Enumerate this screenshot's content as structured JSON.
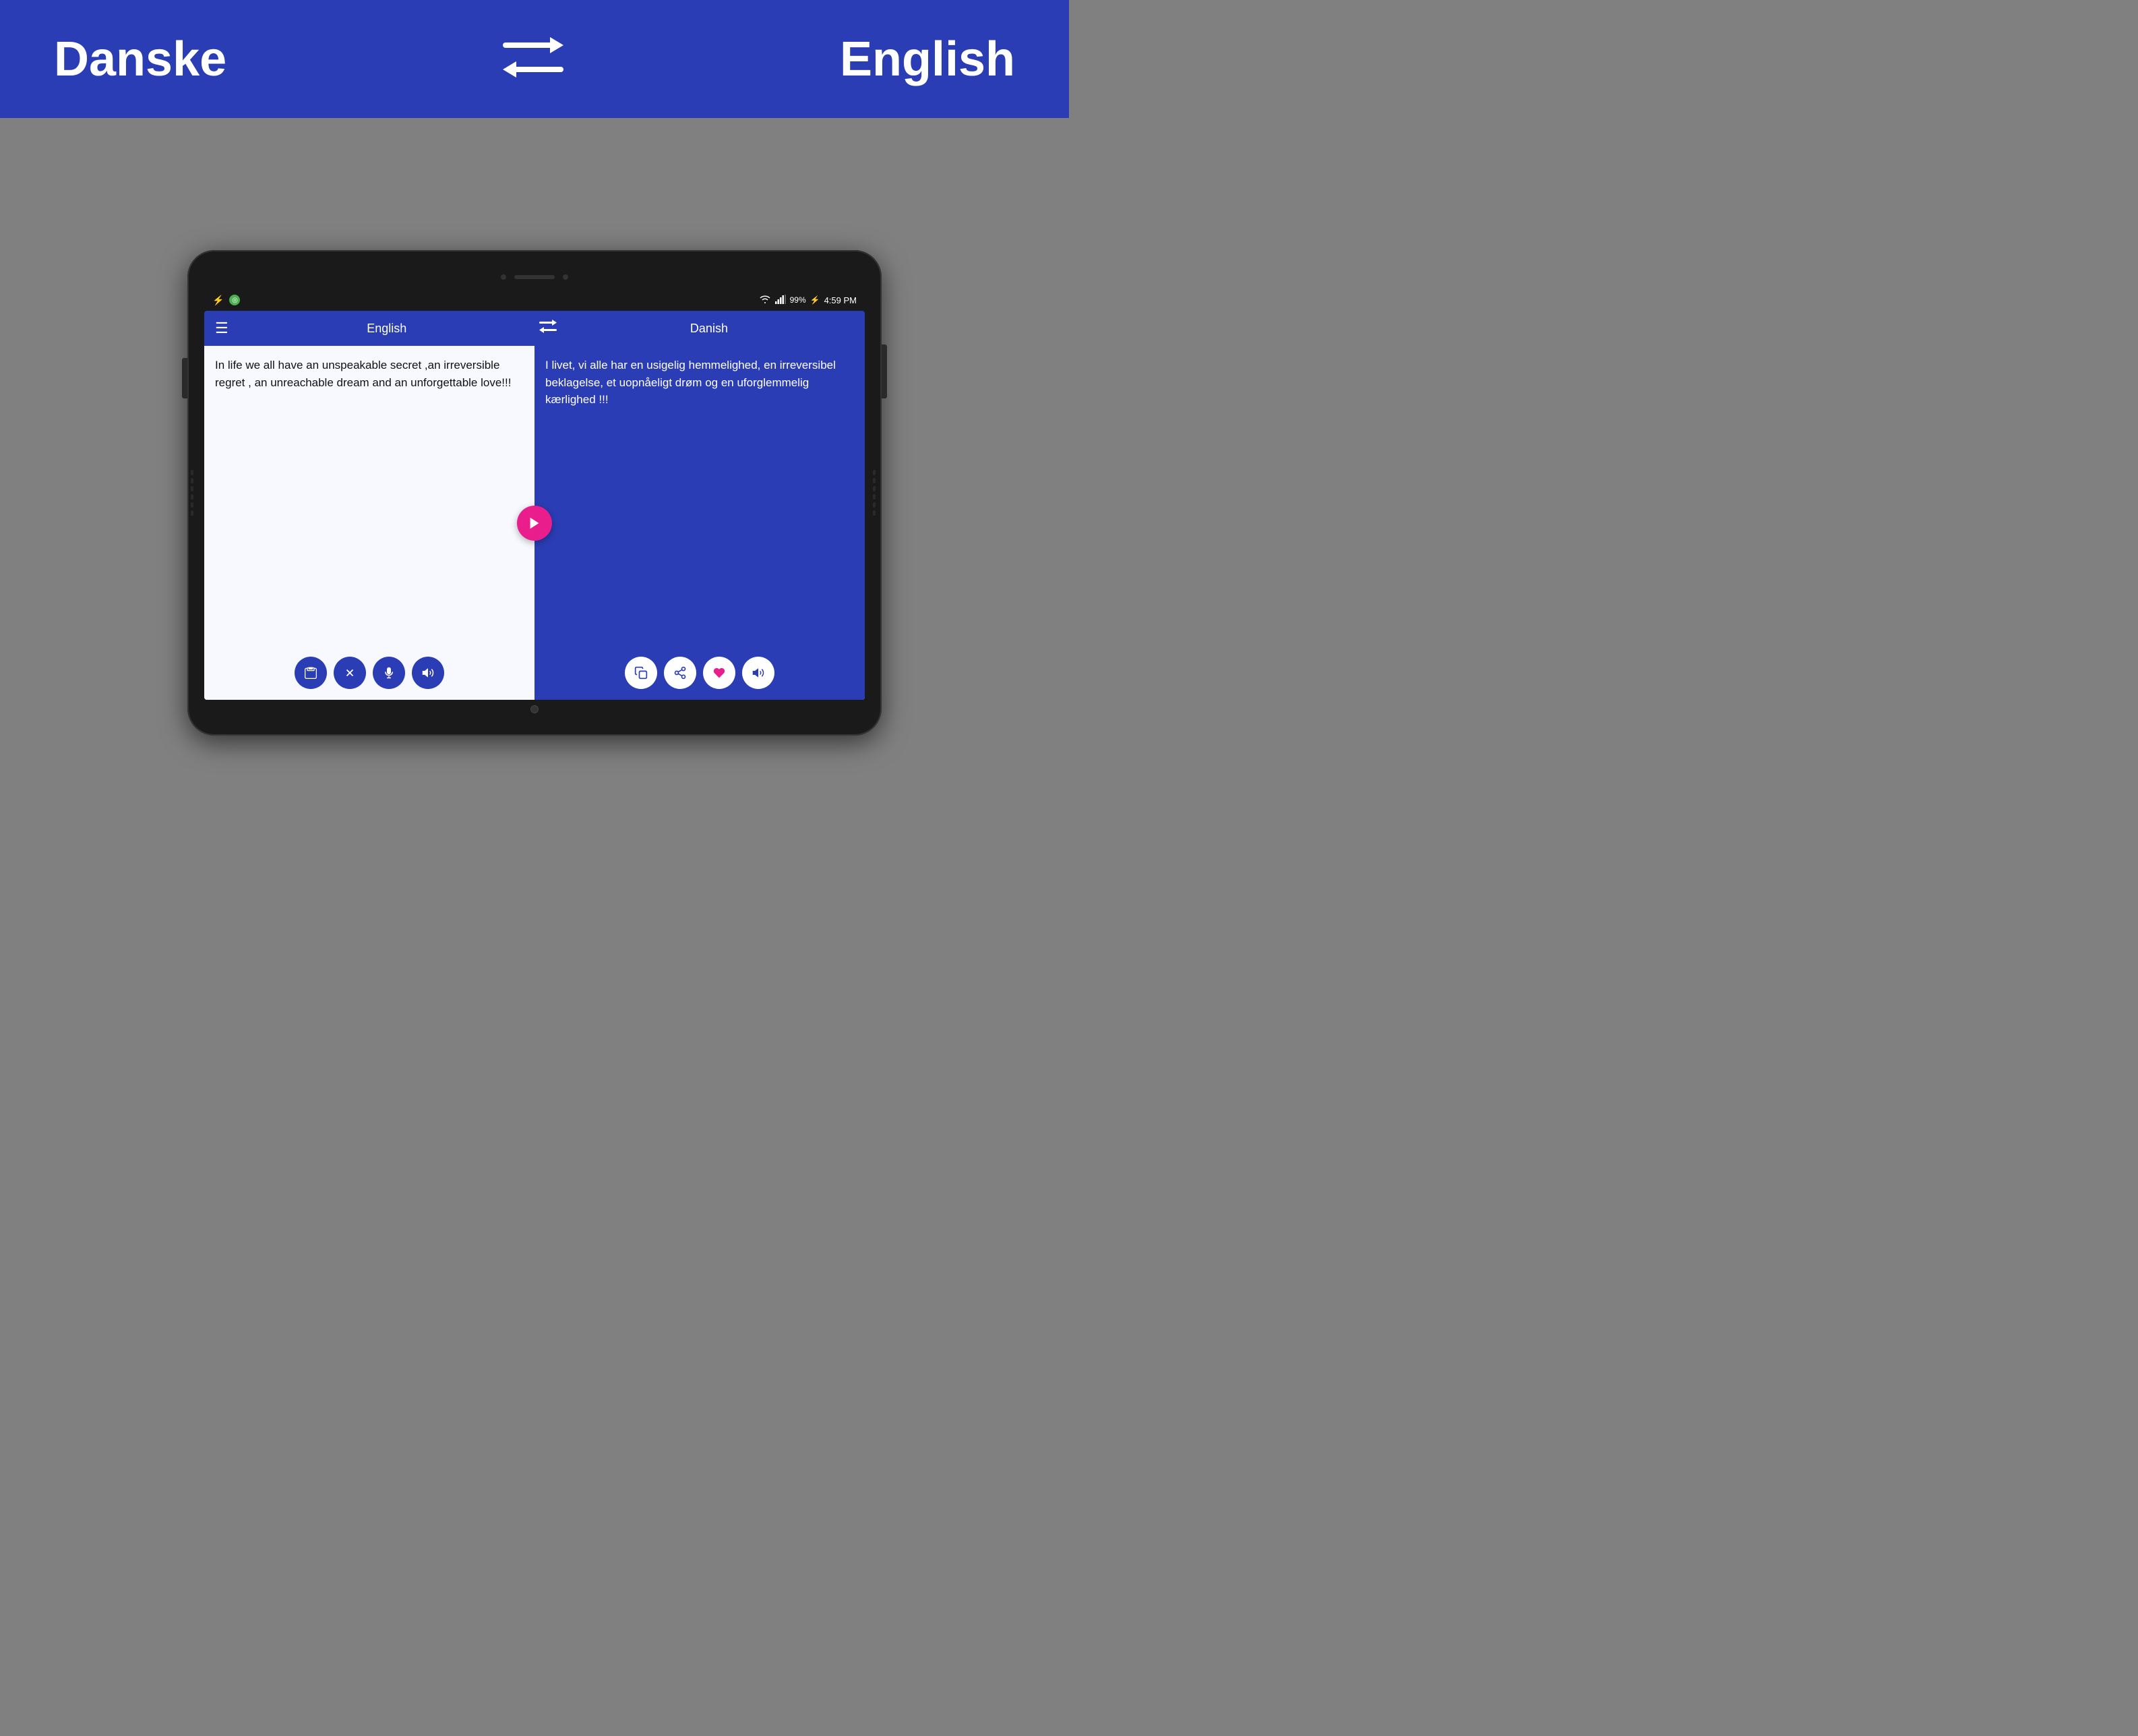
{
  "header": {
    "source_lang": "Danske",
    "target_lang": "English"
  },
  "app": {
    "toolbar": {
      "menu_label": "☰",
      "source_lang": "English",
      "swap_icon": "⇄",
      "target_lang": "Danish"
    },
    "input": {
      "text": "In life we all have an unspeakable secret ,an irreversible regret , an unreachable dream and an unforgettable love!!!",
      "actions": {
        "clipboard": "📋",
        "clear": "✕",
        "microphone": "🎤",
        "speaker": "🔊"
      }
    },
    "output": {
      "text": "I livet, vi alle har en usigelig hemmelighed, en irreversibel beklagelse, et uopnåeligt drøm og en uforglemmelig kærlighed !!!",
      "actions": {
        "copy": "⧉",
        "share": "◁",
        "favorite": "♥",
        "speaker": "🔊"
      }
    },
    "translate_btn": "▶"
  },
  "status_bar": {
    "usb_icon": "⚡",
    "notification_icon": "◎",
    "wifi_icon": "wifi",
    "signal_icon": "signal",
    "battery": "99%",
    "time": "4:59 PM"
  }
}
